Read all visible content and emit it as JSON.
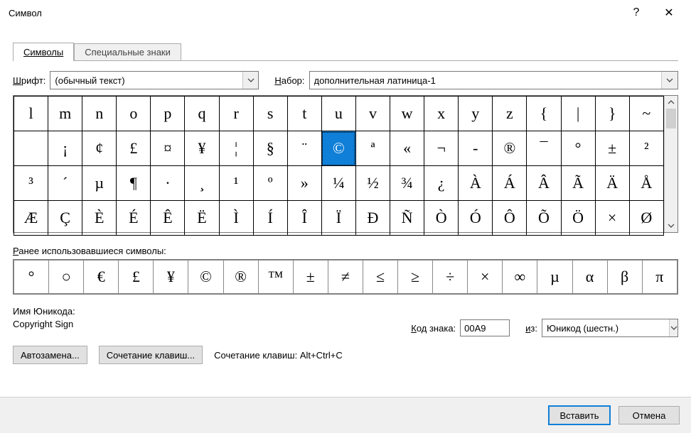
{
  "title": "Символ",
  "tabs": {
    "symbols": "Символы",
    "special": "Специальные знаки"
  },
  "fontLabelPrefix": "Ш",
  "fontLabelRest": "рифт:",
  "fontValue": "(обычный текст)",
  "setLabelPrefix": "Н",
  "setLabelRest": "абор:",
  "setValue": "дополнительная латиница-1",
  "grid": [
    [
      "l",
      "m",
      "n",
      "o",
      "p",
      "q",
      "r",
      "s",
      "t",
      "u",
      "v",
      "w",
      "x",
      "y",
      "z",
      "{",
      "|",
      "}",
      "~"
    ],
    [
      " ",
      "¡",
      "¢",
      "£",
      "¤",
      "¥",
      "¦",
      "§",
      "¨",
      "©",
      "ª",
      "«",
      "¬",
      "-",
      "®",
      "¯",
      "°",
      "±",
      "²"
    ],
    [
      "³",
      "´",
      "µ",
      "¶",
      "·",
      "¸",
      "¹",
      "º",
      "»",
      "¼",
      "½",
      "¾",
      "¿",
      "À",
      "Á",
      "Â",
      "Ã",
      "Ä",
      "Å"
    ],
    [
      "Æ",
      "Ç",
      "È",
      "É",
      "Ê",
      "Ë",
      "Ì",
      "Í",
      "Î",
      "Ï",
      "Đ",
      "Ñ",
      "Ò",
      "Ó",
      "Ô",
      "Õ",
      "Ö",
      "×",
      "Ø"
    ]
  ],
  "selected": {
    "row": 1,
    "col": 9
  },
  "recentLabelPrefix": "Р",
  "recentLabelRest": "анее использовавшиеся символы:",
  "recent": [
    "°",
    "○",
    "€",
    "£",
    "¥",
    "©",
    "®",
    "™",
    "±",
    "≠",
    "≤",
    "≥",
    "÷",
    "×",
    "∞",
    "µ",
    "α",
    "β",
    "π"
  ],
  "unicodeNameLabel": "Имя Юникода:",
  "unicodeName": "Copyright Sign",
  "codeLabelPrefix": "К",
  "codeLabelRest": "од знака:",
  "codeValue": "00A9",
  "fromLabelPrefix": "и",
  "fromLabelRest": "з:",
  "fromValue": "Юникод (шестн.)",
  "autocorrect": "Автозамена...",
  "shortcut": "Сочетание клавиш...",
  "shortcutInfoLabel": "Сочетание клавиш:",
  "shortcutInfoValue": "Alt+Ctrl+C",
  "insert": "Вставить",
  "cancel": "Отмена",
  "helpGlyph": "?",
  "closeGlyph": "✕"
}
